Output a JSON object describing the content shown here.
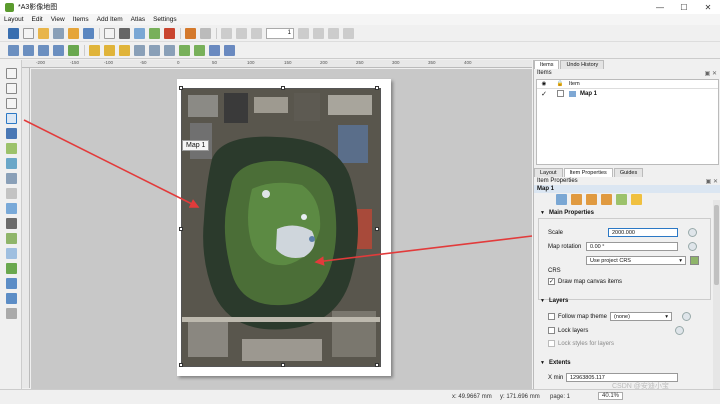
{
  "window": {
    "title": "*A3影像地图",
    "minimize": "—",
    "maximize": "☐",
    "close": "✕"
  },
  "menu": [
    "Layout",
    "Edit",
    "View",
    "Items",
    "Add Item",
    "Atlas",
    "Settings"
  ],
  "toolbar": {
    "page_input": "1"
  },
  "rulers": {
    "h_ticks": [
      "-200",
      "-150",
      "-100",
      "-50",
      "0",
      "50",
      "100",
      "150",
      "200",
      "250",
      "300",
      "350",
      "400"
    ]
  },
  "canvas": {
    "map_label_tooltip": "Map 1"
  },
  "items_panel": {
    "tabs": [
      "Items",
      "Undo History"
    ],
    "header": "Items",
    "col_item": "Item",
    "rows": [
      {
        "checked": true,
        "label": "Map 1"
      }
    ]
  },
  "props_panel": {
    "tabs": [
      "Layout",
      "Item Properties",
      "Guides"
    ],
    "header": "Item Properties",
    "item_name": "Map 1",
    "main_props_title": "Main Properties",
    "scale_label": "Scale",
    "scale_value": "2000.000",
    "rotation_label": "Map rotation",
    "rotation_value": "0.00 °",
    "crs_select": "Use project CRS",
    "crs_label": "CRS",
    "draw_canvas_items": "Draw map canvas items",
    "layers_title": "Layers",
    "follow_theme": "Follow map theme",
    "theme_value": "(none)",
    "lock_layers": "Lock layers",
    "lock_styles": "Lock styles for layers",
    "extents_title": "Extents",
    "xmin_label": "X min",
    "xmin_value": "12963805.117"
  },
  "status": {
    "x": "x: 49.9667 mm",
    "y": "y: 171.696 mm",
    "page": "page: 1",
    "zoom": "40.1%"
  },
  "watermark": "CSDN @安迪小宝",
  "colors": {
    "accent": "#2b78c5",
    "arrow": "#e23b3b",
    "selection": "#d8e6f5"
  }
}
